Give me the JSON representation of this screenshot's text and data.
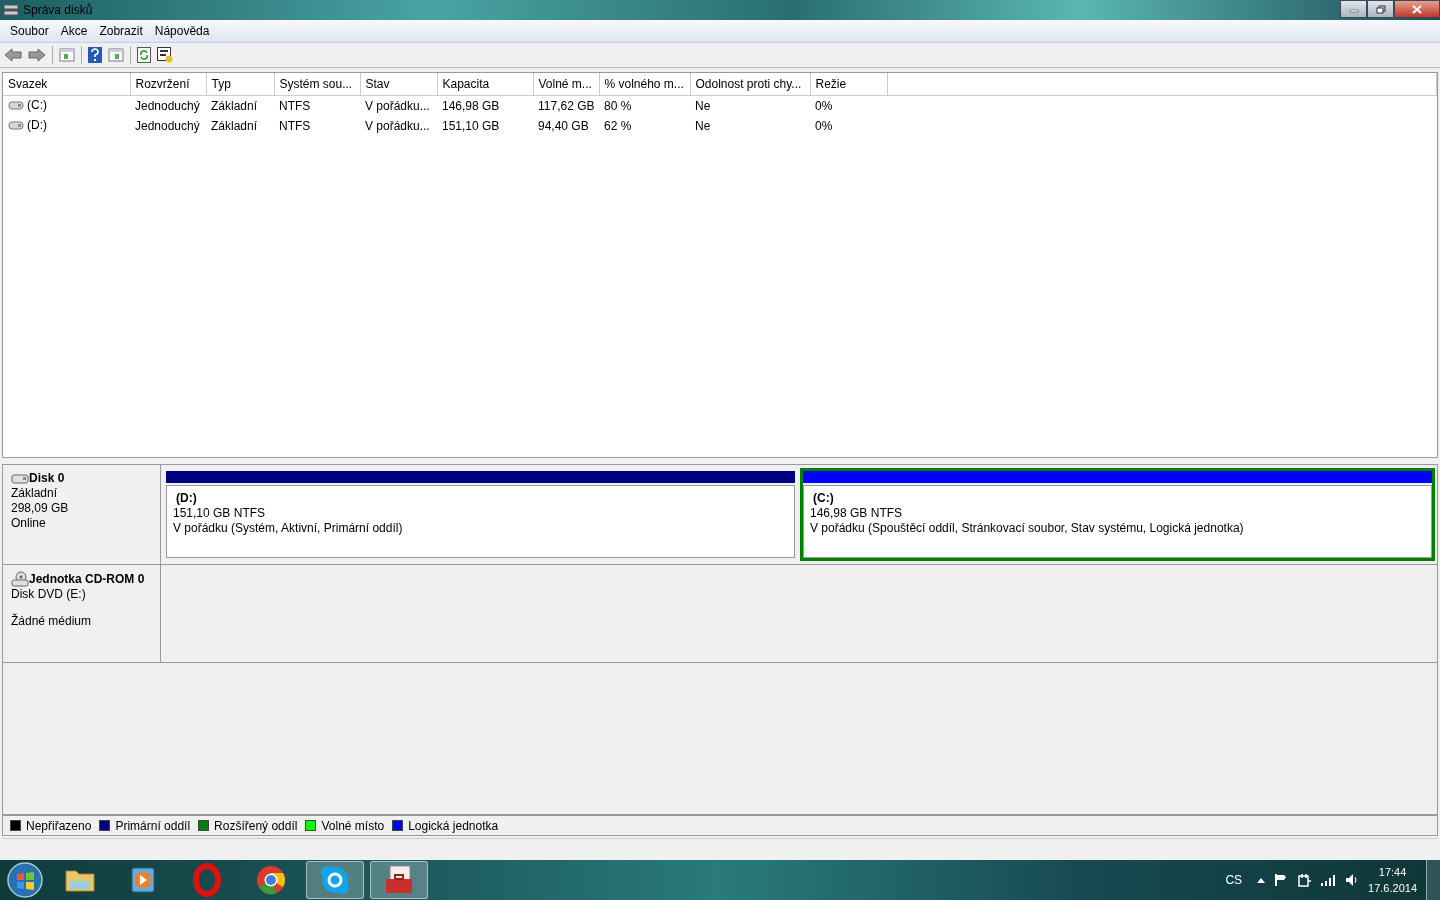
{
  "window": {
    "title": "Správa disků"
  },
  "menu": [
    "Soubor",
    "Akce",
    "Zobrazit",
    "Nápověda"
  ],
  "volumes": {
    "columns": [
      "Svazek",
      "Rozvržení",
      "Typ",
      "Systém sou...",
      "Stav",
      "Kapacita",
      "Volné m...",
      "% volného m...",
      "Odolnost proti chy...",
      "Režie"
    ],
    "rows": [
      [
        "(C:)",
        "Jednoduchý",
        "Základní",
        "NTFS",
        "V pořádku...",
        "146,98 GB",
        "117,62 GB",
        "80 %",
        "Ne",
        "0%"
      ],
      [
        "(D:)",
        "Jednoduchý",
        "Základní",
        "NTFS",
        "V pořádku...",
        "151,10 GB",
        "94,40 GB",
        "62 %",
        "Ne",
        "0%"
      ]
    ]
  },
  "disks": [
    {
      "kind": "disk",
      "name": "Disk 0",
      "details": [
        "Základní",
        "298,09 GB",
        "Online"
      ],
      "partitions": [
        {
          "label": "(D:)",
          "size": "151,10 GB NTFS",
          "status": "V pořádku (Systém, Aktivní, Primární oddíl)",
          "color": "#000080",
          "selected": false
        },
        {
          "label": "(C:)",
          "size": "146,98 GB NTFS",
          "status": "V pořádku (Spouštěcí oddíl, Stránkovací soubor, Stav systému, Logická jednotka)",
          "color": "#0000ff",
          "selected": true
        }
      ]
    },
    {
      "kind": "cdrom",
      "name": "Jednotka CD-ROM 0",
      "details": [
        "Disk DVD (E:)"
      ],
      "status": "Žádné médium"
    }
  ],
  "legend": [
    {
      "label": "Nepřiřazeno",
      "color": "#000000"
    },
    {
      "label": "Primární oddíl",
      "color": "#000080"
    },
    {
      "label": "Rozšířený oddíl",
      "color": "#008000"
    },
    {
      "label": "Volné místo",
      "color": "#00ff00"
    },
    {
      "label": "Logická jednotka",
      "color": "#0000ff"
    }
  ],
  "taskbar": {
    "apps": [
      {
        "kind": "folder",
        "running": false
      },
      {
        "kind": "player",
        "running": false
      },
      {
        "kind": "ring",
        "running": false
      },
      {
        "kind": "browser",
        "running": false
      },
      {
        "kind": "chat",
        "running": true
      },
      {
        "kind": "toolbox",
        "running": true
      }
    ],
    "language": "CS",
    "time": "17:44",
    "date": "17.6.2014"
  }
}
